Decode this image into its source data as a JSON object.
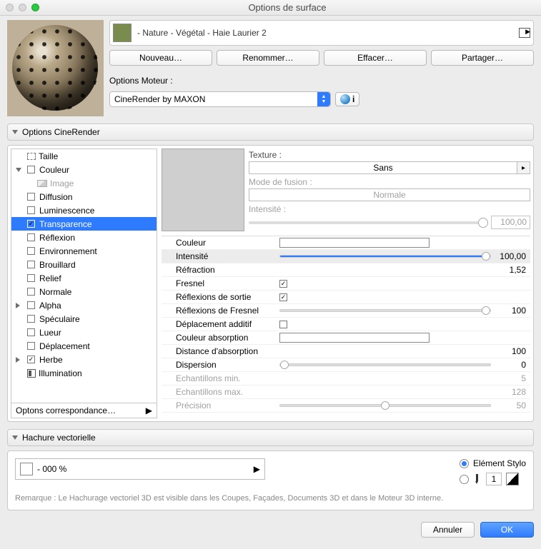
{
  "window": {
    "title": "Options de surface"
  },
  "material": {
    "path": " - Nature - Végétal - Haie Laurier 2",
    "swatch_color": "#7a8b4e"
  },
  "buttons": {
    "new": "Nouveau…",
    "rename": "Renommer…",
    "delete": "Effacer…",
    "share": "Partager…",
    "cancel": "Annuler",
    "ok": "OK"
  },
  "engine": {
    "label": "Options Moteur :",
    "value": "CineRender by MAXON",
    "info": "i"
  },
  "sections": {
    "cinerender": "Options CineRender",
    "hatch": "Hachure vectorielle"
  },
  "tree": {
    "size": "Taille",
    "color": "Couleur",
    "image": "Image",
    "diffusion": "Diffusion",
    "luminescence": "Luminescence",
    "transparency": "Transparence",
    "reflection": "Réflexion",
    "environment": "Environnement",
    "fog": "Brouillard",
    "relief": "Relief",
    "normal": "Normale",
    "alpha": "Alpha",
    "specular": "Spéculaire",
    "glow": "Lueur",
    "displacement": "Déplacement",
    "grass": "Herbe",
    "illumination": "Illumination",
    "match": "Optons correspondance…"
  },
  "texture_panel": {
    "texture_label": "Texture :",
    "texture_value": "Sans",
    "blend_label": "Mode de fusion :",
    "blend_value": "Normale",
    "intensity_label": "Intensité :",
    "intensity_value": "100,00"
  },
  "props": {
    "color": {
      "name": "Couleur"
    },
    "intensity": {
      "name": "Intensité",
      "value": "100,00"
    },
    "refraction": {
      "name": "Réfraction",
      "value": "1,52"
    },
    "fresnel": {
      "name": "Fresnel"
    },
    "exit_reflections": {
      "name": "Réflexions de sortie"
    },
    "fresnel_reflectivity": {
      "name": "Réflexions de Fresnel",
      "value": "100"
    },
    "additive": {
      "name": "Déplacement additif"
    },
    "absorption_color": {
      "name": "Couleur absorption"
    },
    "absorption_distance": {
      "name": "Distance d'absorption",
      "value": "100"
    },
    "dispersion": {
      "name": "Dispersion",
      "value": "0"
    },
    "samples_min": {
      "name": "Echantillons min.",
      "value": "5"
    },
    "samples_max": {
      "name": "Echantillons max.",
      "value": "128"
    },
    "precision": {
      "name": "Précision",
      "value": "50"
    }
  },
  "hatch": {
    "value": " - 000 %",
    "element_pen": "Elément Stylo",
    "pen_num": "1"
  },
  "note": "Remarque : Le Hachurage vectoriel 3D est visible dans les Coupes, Façades, Documents 3D et dans le Moteur 3D interne."
}
